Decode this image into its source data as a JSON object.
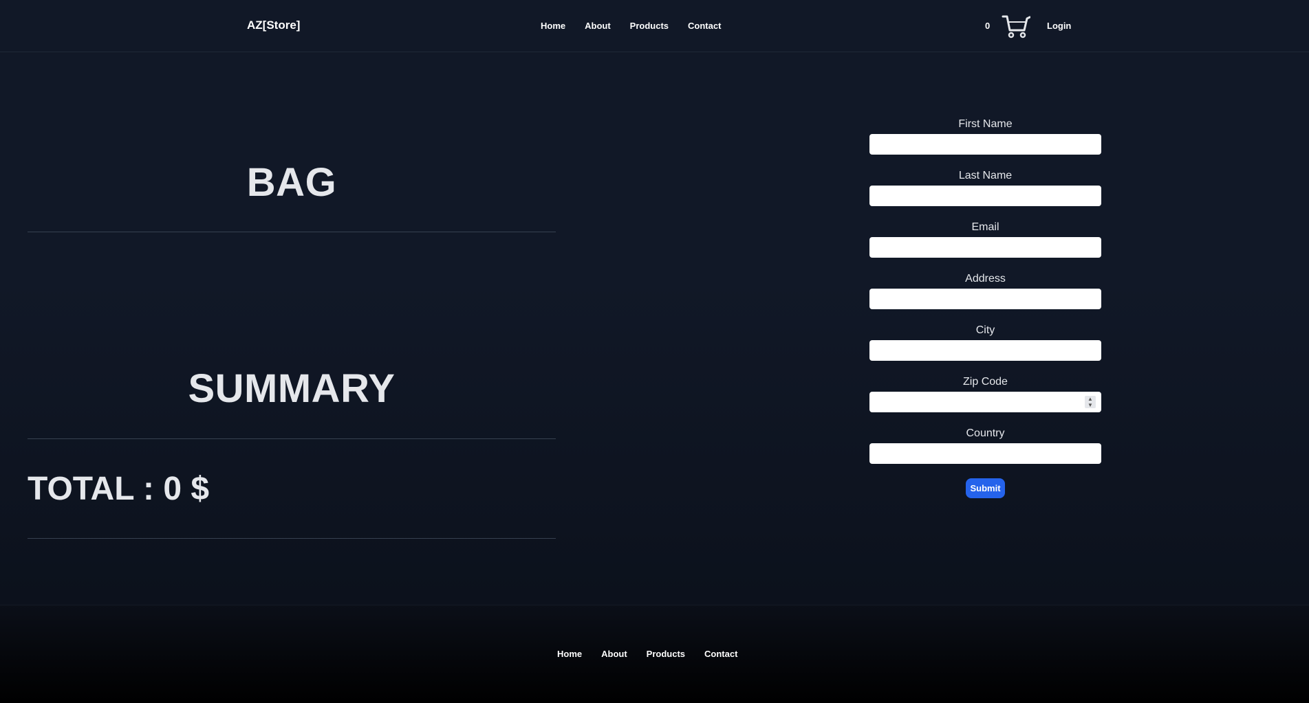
{
  "header": {
    "brand": "AZ[Store]",
    "nav": [
      "Home",
      "About",
      "Products",
      "Contact"
    ],
    "cart_count": "0",
    "cart_icon": "cart-icon",
    "login": "Login"
  },
  "main": {
    "bag_title": "BAG",
    "summary_title": "SUMMARY",
    "total": "TOTAL : 0 $"
  },
  "form": {
    "fields": [
      {
        "label": "First Name",
        "value": ""
      },
      {
        "label": "Last Name",
        "value": ""
      },
      {
        "label": "Email",
        "value": ""
      },
      {
        "label": "Address",
        "value": ""
      },
      {
        "label": "City",
        "value": ""
      },
      {
        "label": "Zip Code",
        "value": ""
      },
      {
        "label": "Country",
        "value": ""
      }
    ],
    "submit_label": "Submit"
  },
  "footer": {
    "nav": [
      "Home",
      "About",
      "Products",
      "Contact"
    ]
  },
  "colors": {
    "background": "#111827",
    "accent": "#2563eb",
    "text": "#e5e7eb"
  }
}
